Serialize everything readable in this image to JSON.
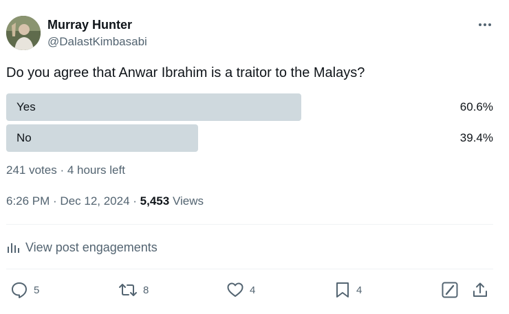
{
  "author": {
    "display_name": "Murray Hunter",
    "handle": "@DalastKimbasabi"
  },
  "poll": {
    "question": "Do you agree that Anwar Ibrahim is a traitor to the Malays?",
    "options": [
      {
        "label": "Yes",
        "percent": "60.6%",
        "fraction": 0.606
      },
      {
        "label": "No",
        "percent": "39.4%",
        "fraction": 0.394
      }
    ],
    "meta": "241 votes · 4 hours left",
    "bar_color": "#cfd9de"
  },
  "post": {
    "time": "6:26 PM",
    "date": "Dec 12, 2024",
    "views_count": "5,453",
    "views_label": "Views"
  },
  "engagements_label": "View post engagements",
  "actions": {
    "reply_count": "5",
    "repost_count": "8",
    "like_count": "4",
    "bookmark_count": "4"
  },
  "colors": {
    "text_primary": "#0f1419",
    "text_secondary": "#536471",
    "divider": "#eff3f4"
  },
  "icons": [
    "more-icon",
    "analytics-icon",
    "reply-icon",
    "repost-icon",
    "like-icon",
    "bookmark-icon",
    "grok-icon",
    "share-icon"
  ]
}
